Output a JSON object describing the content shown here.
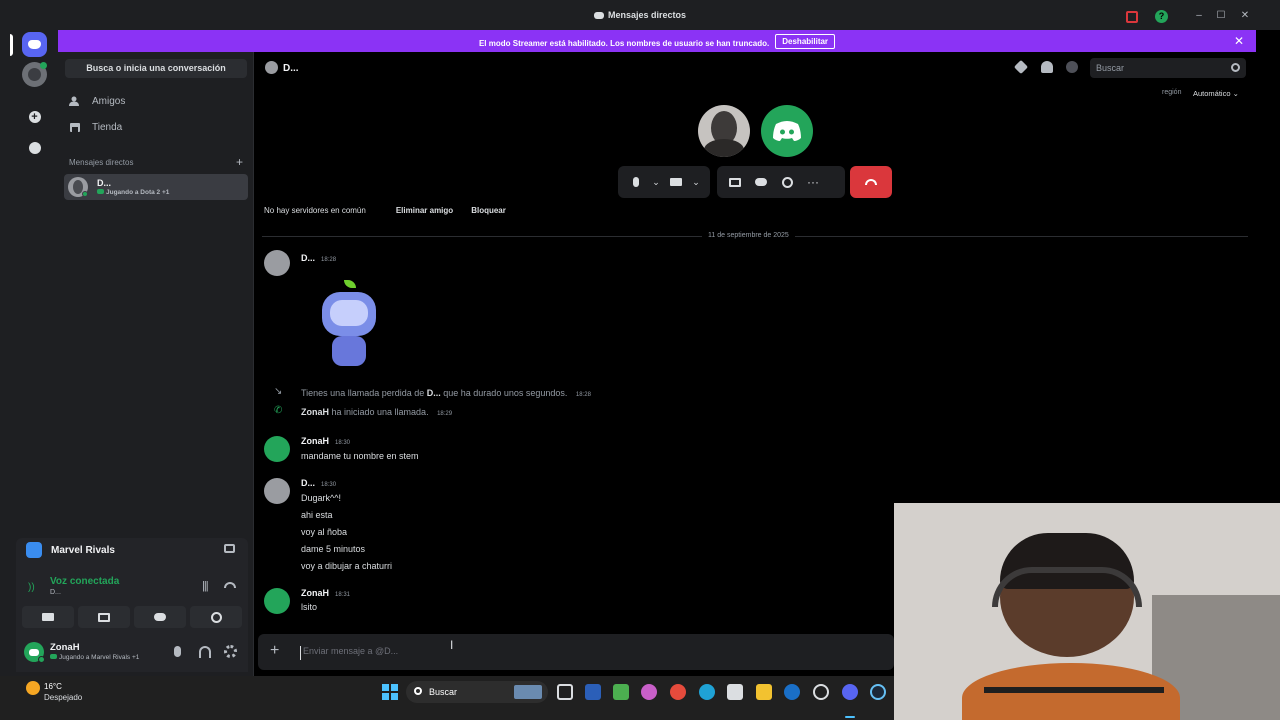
{
  "window": {
    "title": "Mensajes directos"
  },
  "banner": {
    "text": "El modo Streamer está habilitado. Los nombres de usuario se han truncado.",
    "button": "Deshabilitar"
  },
  "sidebar": {
    "search": "Busca o inicia una conversación",
    "nav": [
      {
        "label": "Amigos",
        "icon": "friends-icon"
      },
      {
        "label": "Tienda",
        "icon": "shop-icon"
      }
    ],
    "dm_header": "Mensajes directos",
    "dm": {
      "name": "D...",
      "status": "Jugando a Dota 2",
      "extra": "+1"
    }
  },
  "voice": {
    "game": "Marvel Rivals",
    "status": "Voz conectada",
    "channel": "D..."
  },
  "user": {
    "name": "ZonaH",
    "status": "Jugando a Marvel Rivals",
    "extra": "+1"
  },
  "header": {
    "name": "D...",
    "search_placeholder": "Buscar",
    "region_label": "región",
    "region_value": "Automático"
  },
  "profile": {
    "no_servers": "No hay servidores en común",
    "remove_friend": "Eliminar amigo",
    "block": "Bloquear"
  },
  "chat": {
    "date": "11 de septiembre de 2025",
    "m1": {
      "author": "D...",
      "time": "18:28"
    },
    "sys1": {
      "pre": "Tienes una llamada perdida de ",
      "who": "D...",
      "post": " que ha durado unos segundos.",
      "time": "18:28"
    },
    "sys2": {
      "who": "ZonaH",
      "text": " ha iniciado una llamada.",
      "time": "18:29"
    },
    "m2": {
      "author": "ZonaH",
      "time": "18:30",
      "lines": [
        "mandame tu nombre en stem"
      ]
    },
    "m3": {
      "author": "D...",
      "time": "18:30",
      "lines": [
        "Dugark^^!",
        "ahi esta",
        "voy al ñoba",
        "dame 5 minutos",
        "voy a dibujar a chaturri"
      ]
    },
    "m4": {
      "author": "ZonaH",
      "time": "18:31",
      "lines": [
        "lsito"
      ]
    }
  },
  "composer": {
    "placeholder": "Enviar mensaje a @D..."
  },
  "taskbar": {
    "weather_temp": "16°C",
    "weather_desc": "Despejado",
    "search": "Buscar"
  },
  "colors": {
    "accent": "#5865f2",
    "banner": "#8b33f5",
    "green": "#23a55a",
    "danger": "#da373c"
  }
}
